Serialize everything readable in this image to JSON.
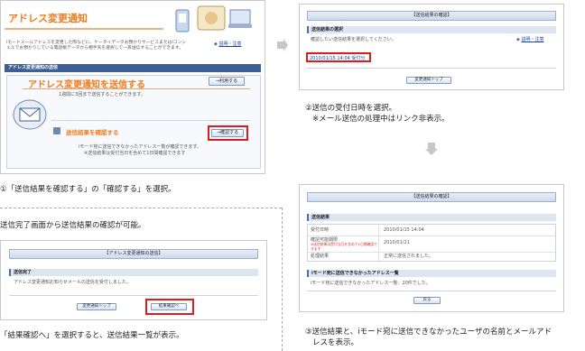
{
  "panel1": {
    "title": "アドレス変更通知",
    "intro": "iモードメールアドレスを変更した際などに、ケータイデータお預かりサービスまたはiコンシェルでお預かりしている電話帳データから相手先を選択して一斉送信することができます。",
    "help": "説明・注意",
    "section_title": "アドレス変更通知の送信",
    "send_heading": "アドレス変更通知を送信する",
    "use_button": "→利用する",
    "send_desc": "1週間に3回まで送信することができます。",
    "confirm_heading": "送信結果を確認する",
    "confirm_button": "→確認する",
    "confirm_desc1": "iモード宛に送信できなかったアドレス一覧が確認できます。",
    "confirm_desc2": "※送信結果は受付当日を含めて1日間確認できます"
  },
  "caption1": "①「送信結果を確認する」の「確認する」を選択。",
  "panel2": {
    "header": "【送信結果の確認】",
    "section": "送信結果の選択",
    "desc": "確認したい送信結果を選択してください。",
    "help": "説明・注意",
    "link": "2010/01/15 14:04 受付分",
    "top_button": "変更通知トップ"
  },
  "caption2": {
    "line1": "②送信の受付日時を選択。",
    "line2": "※メール送信の処理中はリンク非表示。"
  },
  "panel3": {
    "header": "【送信結果の確認】",
    "section": "送信結果",
    "rows": [
      {
        "label": "受付日時",
        "value": "2010/01/15 14:04"
      },
      {
        "label": "確認可能期限",
        "value": "2010/01/21"
      },
      {
        "label": "処理結果",
        "value": "正常に送信されました。"
      }
    ],
    "row2_note": "※送信結果は受付当日を含めて1日間確認できます",
    "section2": "iモード宛に送信できなかったアドレス一覧",
    "desc2": "iモード宛に送信できなかったアドレス一覧：20件でした。",
    "back_button": "戻る"
  },
  "caption3": {
    "line1": "③送信結果と、iモード宛に送信できなかったユーザの名前とメールアド",
    "line2": "レスを表示。"
  },
  "note_title": "送信完了画面から送信結果の確認が可能。",
  "panel4": {
    "header": "【アドレス変更通知の送信】",
    "section": "送信完了",
    "desc": "アドレス変更通知お知らせメールの送信を受付しました。",
    "top_button": "変更通知トップ",
    "result_button": "結果確認へ"
  },
  "caption4": "「結果確認へ」を選択すると、送信結果一覧が表示。",
  "colors": {
    "accent": "#f07b1a",
    "highlight": "#e01b1b",
    "link": "#1a3fa8",
    "navy": "#4a6fa5"
  }
}
